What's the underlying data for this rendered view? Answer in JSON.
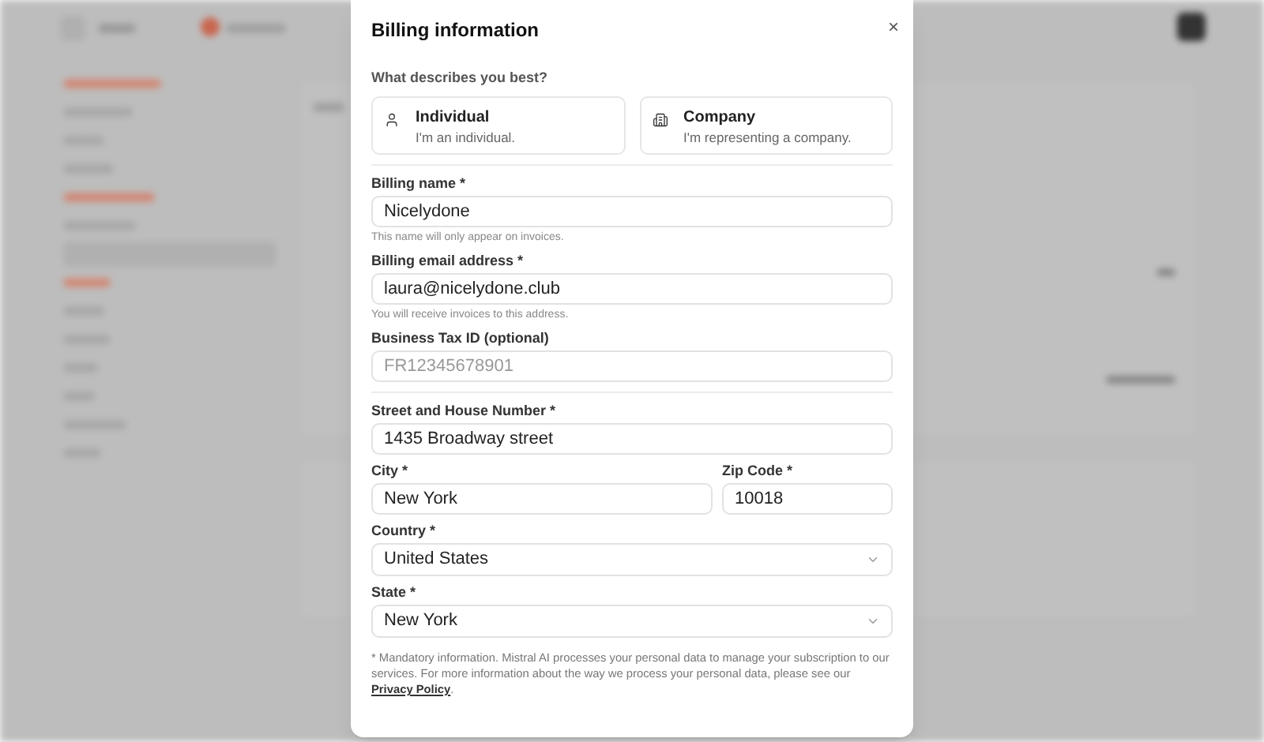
{
  "dialog": {
    "title": "Billing information",
    "close": "×",
    "question": "What describes you best?",
    "options": [
      {
        "kind": "person",
        "title": "Individual",
        "subtitle": "I'm an individual.",
        "selected": false
      },
      {
        "kind": "building",
        "title": "Company",
        "subtitle": "I'm representing a company.",
        "selected": false
      }
    ],
    "fields": [
      {
        "kind": "divider"
      },
      {
        "kind": "text",
        "label": "Billing name *",
        "value": "Nicelydone",
        "help": "This name will only appear on invoices."
      },
      {
        "kind": "text",
        "label": "Billing email address *",
        "value": "laura@nicelydone.club",
        "help": "You will receive invoices to this address."
      },
      {
        "kind": "text",
        "label": "Business Tax ID (optional)",
        "placeholder": "FR12345678901"
      },
      {
        "kind": "divider"
      },
      {
        "kind": "text",
        "label": "Street and House Number *",
        "value": "1435 Broadway street"
      },
      {
        "kind": "pair",
        "items": [
          {
            "label": "City *",
            "value": "New York"
          },
          {
            "label": "Zip Code *",
            "value": "10018"
          }
        ]
      },
      {
        "kind": "select",
        "label": "Country *",
        "value": "United States"
      },
      {
        "kind": "select",
        "label": "State *",
        "value": "New York"
      }
    ],
    "footnote": {
      "text": "* Mandatory information. Mistral AI processes your personal data to manage your subscription to our services. For more information about the way we process your personal data, please see our ",
      "link": "Privacy Policy",
      "end": "."
    }
  }
}
